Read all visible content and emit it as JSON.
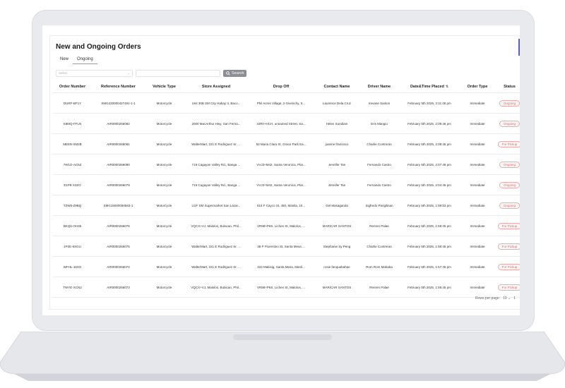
{
  "page": {
    "title": "New and Ongoing Orders"
  },
  "tabs": [
    {
      "label": "New",
      "active": false
    },
    {
      "label": "Ongoing",
      "active": true
    }
  ],
  "filter": {
    "select_placeholder": "Select",
    "search_label": "Search"
  },
  "table": {
    "columns": [
      "Order Number",
      "Reference Number",
      "Vehicle Type",
      "Store Assigned",
      "Drop Off",
      "Contact Name",
      "Driver Name",
      "Date&Time Placed",
      "Order Type",
      "Status"
    ],
    "rows": [
      {
        "order": "DURF-BF1Y",
        "ref": "SMG220000427491-1-1",
        "vehicle": "Motorcycle",
        "store": "Unit 30B SM City Habay II, Baco...",
        "drop": "Phil Acres Village, 2 Givenchy, S...",
        "contact": "Laurence Dela Cruz",
        "driver": "Irevane Santos",
        "date": "February 5th 2025, 2:11:46 pm",
        "type": "Immediate",
        "status": "Ongoing"
      },
      {
        "order": "K8MQ-FFLN",
        "ref": "AIR0000266082",
        "vehicle": "Motorcycle",
        "store": "2000 MacArthur Hwy, San Ferna...",
        "drop": "3JR0+HCH, unnamed Street, Sa...",
        "contact": "Helen Sundiam",
        "driver": "Eris Mangio",
        "date": "February 5th 2025, 2:09:46 pm",
        "type": "Immediate",
        "status": "Ongoing"
      },
      {
        "order": "ME6N-XM2B",
        "ref": "AIR0000266081",
        "vehicle": "Motorcycle",
        "store": "WalterMart, 221 E Rodriguez Sr. ...",
        "drop": "53 Maria Clara St, Grace Park Ea...",
        "contact": "joanne francisco",
        "driver": "Charlie Contreras",
        "date": "February 5th 2025, 2:08:45 pm",
        "type": "Immediate",
        "status": "For Pickup"
      },
      {
        "order": "7W1O-AC5Z",
        "ref": "AIR0000266080",
        "vehicle": "Motorcycle",
        "store": "719 Cagayan Valley Rd., Banga ...",
        "drop": "VVJ3+M42, Santa Veronica, Plar...",
        "contact": "Jennifer Tan",
        "driver": "Fernando Castro",
        "date": "February 5th 2025, 2:07:48 pm",
        "type": "Immediate",
        "status": "Ongoing"
      },
      {
        "order": "E1P8-X3ZO",
        "ref": "AIR0000266079",
        "vehicle": "Motorcycle",
        "store": "719 Cagayan Valley Rd., Banga ...",
        "drop": "VVJ3+M42, Santa Veronica, Plar...",
        "contact": "Jennifer Tan",
        "driver": "Fernando Castro",
        "date": "February 5th 2025, 2:04:46 pm",
        "type": "Immediate",
        "status": "Ongoing"
      },
      {
        "order": "TZW8-Z9BQ",
        "ref": "SMG15000050583-1",
        "vehicle": "Motorcycle",
        "store": "LGF SM Supermarket San Lazar...",
        "drop": "815 F Cayco St, 450, Manila, 10...",
        "contact": "Gel Masaganda",
        "driver": "Sigfredo Pangilinan",
        "date": "February 5th 2025, 1:59:53 pm",
        "type": "Immediate",
        "status": "Ongoing"
      },
      {
        "order": "BKQ6-OH36",
        "ref": "AIR0000266076",
        "vehicle": "Motorcycle",
        "store": "VQCX+VJ, Malolos, Bulacan, Phil...",
        "drop": "VR98+P6S, Lichen St, Malolos, ...",
        "contact": "MARICAR SANTOS",
        "driver": "Renren Palae",
        "date": "February 5th 2025, 1:59:45 pm",
        "type": "Immediate",
        "status": "For Pickup"
      },
      {
        "order": "1P2E-6XGU",
        "ref": "AIR0000266075",
        "vehicle": "Motorcycle",
        "store": "WalterMart, 221 E Rodriguez Sr. ...",
        "drop": "38 P Florentino St, Santa Mesa ...",
        "contact": "Stephanie Sy Peng",
        "driver": "Charlie Contreras",
        "date": "February 5th 2025, 1:58:45 pm",
        "type": "Immediate",
        "status": "For Pickup"
      },
      {
        "order": "WFHL-16XG",
        "ref": "AIR0000266074",
        "vehicle": "Motorcycle",
        "store": "WalterMart, 221 E Rodriguez Sr. ...",
        "drop": "423 Makisig, Santa Mesa, Manil...",
        "contact": "rosie fanquabahae",
        "driver": "Rom Rom Mababa",
        "date": "February 5th 2025, 1:57:45 pm",
        "type": "Immediate",
        "status": "For Pickup"
      },
      {
        "order": "TWYE-XCN2",
        "ref": "AIR0000266073",
        "vehicle": "Motorcycle",
        "store": "VQCX+VJ, Malolos, Bulacan, Phil...",
        "drop": "VR98+P6S, Lichen St, Malolos, ...",
        "contact": "MARICAR SANTOS",
        "driver": "Renren Palae",
        "date": "February 5th 2025, 1:56:45 pm",
        "type": "Immediate",
        "status": "For Pickup"
      }
    ]
  },
  "pagination": {
    "rows_per_page_label": "Rows per page:",
    "rows_per_page_value": "10",
    "page_info": "1"
  },
  "colors": {
    "badge_text": "#d86a6a",
    "badge_border": "#f0a8a8",
    "search_button": "#8d8d95",
    "accent": "#5c5ccc"
  }
}
